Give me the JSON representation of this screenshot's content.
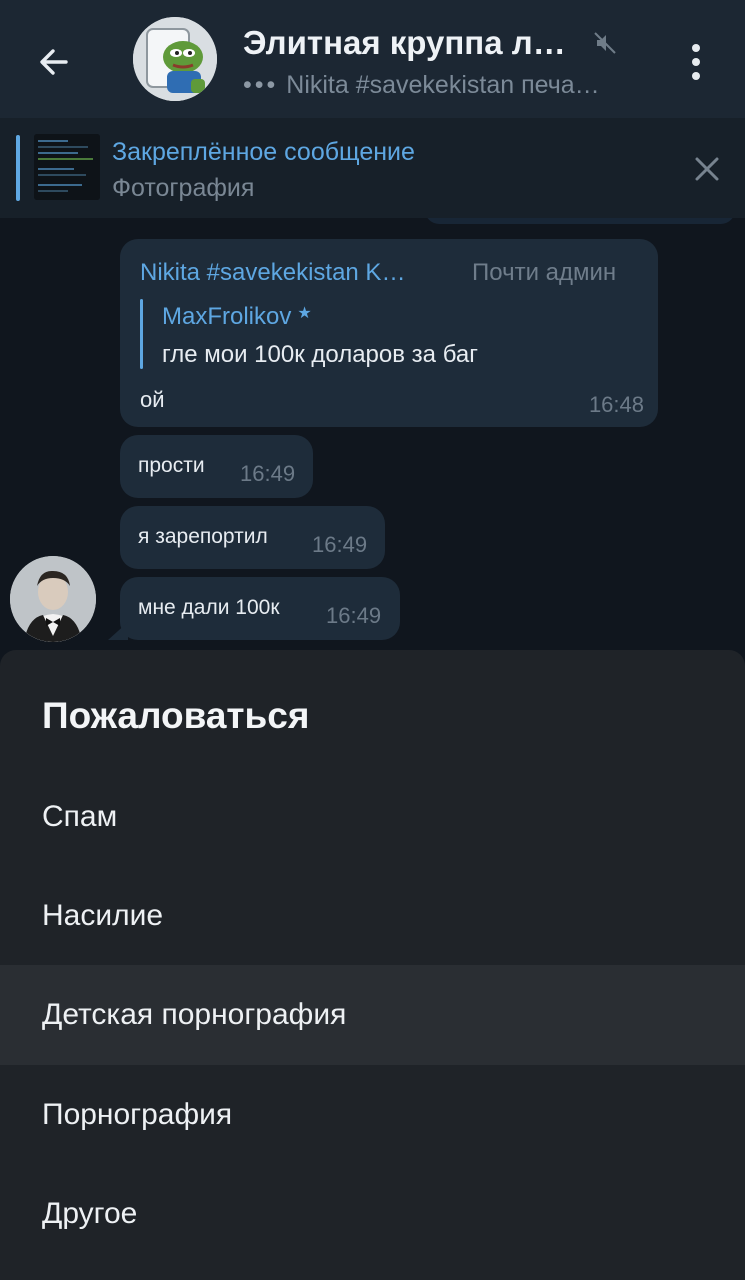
{
  "header": {
    "title": "Элитная круппа л…",
    "subtitle": "Nikita #savekekistan печа…"
  },
  "pinned": {
    "title": "Закреплённое сообщение",
    "subtitle": "Фотография"
  },
  "messages": [
    {
      "sender": "Nikita #savekekistan K…",
      "role": "Почти админ",
      "reply_to_name": "MaxFrolikov",
      "reply_to_text": "гле мои 100к доларов за баг",
      "text": "ой",
      "time": "16:48"
    },
    {
      "text": "прости",
      "time": "16:49"
    },
    {
      "text": "я зарепортил",
      "time": "16:49"
    },
    {
      "text": "мне дали 100к",
      "time": "16:49"
    }
  ],
  "report_sheet": {
    "title": "Пожаловаться",
    "items": [
      {
        "label": "Спам"
      },
      {
        "label": "Насилие"
      },
      {
        "label": "Детская порнография"
      },
      {
        "label": "Порнография"
      },
      {
        "label": "Другое"
      }
    ]
  },
  "icons": {
    "back": "arrow-left-icon",
    "mute": "muted-speaker-icon",
    "menu": "three-dots-vertical-icon",
    "close": "close-icon"
  },
  "colors": {
    "accent": "#5ea7e2",
    "header_bg": "#1c2733",
    "chat_bg": "#10161e",
    "bubble_bg": "#1e2c3a",
    "sheet_bg": "#1f2328"
  }
}
